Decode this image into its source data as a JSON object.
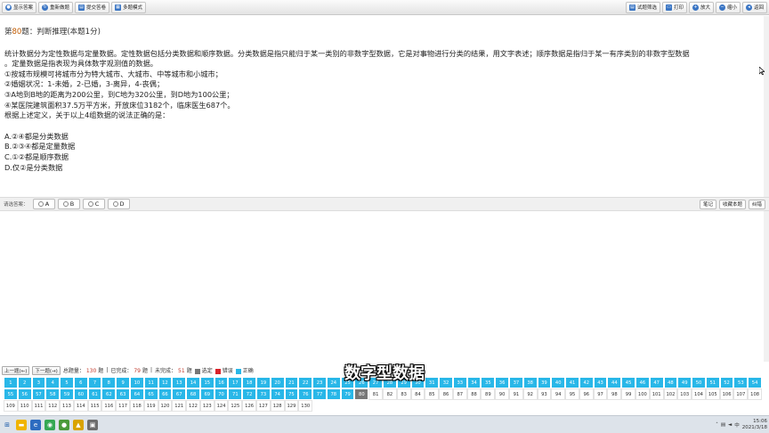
{
  "toolbar": {
    "left": [
      {
        "label": "显示答案",
        "icon": "eye-icon"
      },
      {
        "label": "重新做题",
        "icon": "refresh-icon"
      },
      {
        "label": "提交答卷",
        "icon": "submit-icon"
      },
      {
        "label": "多题模式",
        "icon": "grid-icon"
      }
    ],
    "right": [
      {
        "label": "试题筛选",
        "icon": "filter-icon"
      },
      {
        "label": "打印",
        "icon": "printer-icon"
      },
      {
        "label": "放大",
        "icon": "zoom-in-icon"
      },
      {
        "label": "缩小",
        "icon": "zoom-out-icon"
      },
      {
        "label": "返回",
        "icon": "back-icon"
      }
    ]
  },
  "question": {
    "prefix": "第",
    "number": "80",
    "suffix": "题：判断推理(本题1分)",
    "lines": [
      "统计数据分为定性数据与定量数据。定性数据包括分类数据和顺序数据。分类数据是指只能归于某一类别的非数字型数据，它是对事物进行分类的结果，用文字表述；顺序数据是指归于某一有序类别的非数字型数据",
      "。定量数据是指表现为具体数字观测值的数据。",
      "①按城市规模可将城市分为特大城市、大城市、中等城市和小城市；",
      "②婚姻状况：1-未婚，2-已婚，3-离异，4-丧偶；",
      "③A地到B地的距离为200公里，到C地为320公里，到D地为100公里；",
      "④某医院建筑面积37.5万平方米，开放床位3182个，临床医生687个。",
      "根据上述定义，关于以上4组数据的说法正确的是："
    ],
    "options": [
      "A.②④都是分类数据",
      "B.②③④都是定量数据",
      "C.①②都是顺序数据",
      "D.仅②是分类数据"
    ]
  },
  "answer_bar": {
    "label": "请选答案：",
    "choices": [
      "A",
      "B",
      "C",
      "D"
    ],
    "right_buttons": [
      "笔记",
      "收藏本题",
      "纠错"
    ]
  },
  "status": {
    "prev": "上一题(←)",
    "next": "下一题(→)",
    "total_label": "总题量：",
    "total": "130",
    "total_unit": "题",
    "done_label": "已完成：",
    "done": "79",
    "done_unit": "题",
    "todo_label": "未完成：",
    "todo": "51",
    "todo_unit": "题",
    "legend": [
      {
        "label": "选定",
        "color": "#777777"
      },
      {
        "label": "错误",
        "color": "#d9232a"
      },
      {
        "label": "正确",
        "color": "#29b7e8"
      }
    ]
  },
  "grid": {
    "total": 130,
    "answered_through": 79,
    "current": 80
  },
  "subtitle": "数字型数据",
  "taskbar": {
    "time": "15:06",
    "date": "2021/3/18"
  },
  "colors": {
    "accent": "#29b7e8",
    "current": "#777777",
    "number": "#c05a00"
  }
}
